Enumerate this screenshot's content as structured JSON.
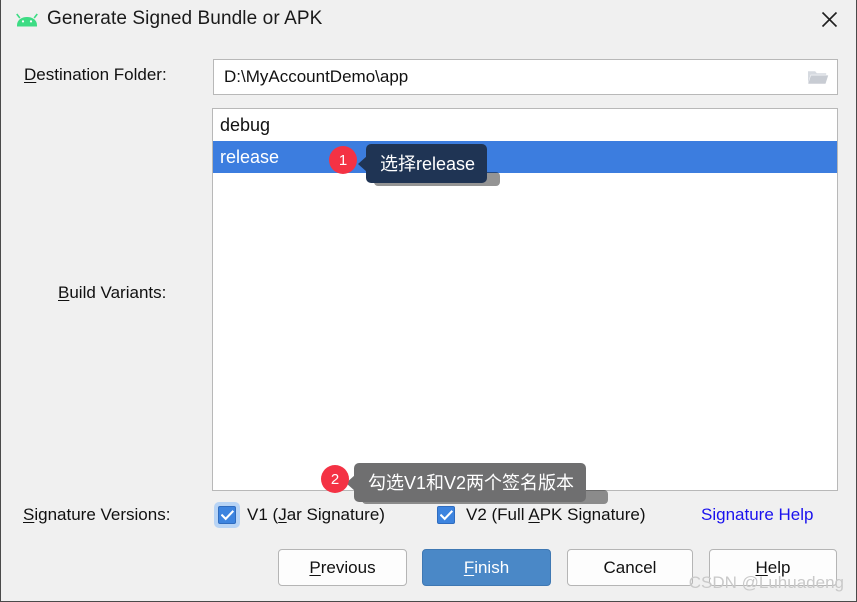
{
  "window": {
    "title": "Generate Signed Bundle or APK",
    "app_icon": "android-robot-icon",
    "close_icon": "close-icon"
  },
  "destination": {
    "label_pre": "D",
    "label_post": "estination Folder:",
    "value": "D:\\MyAccountDemo\\app",
    "placeholder": "Destination Folder",
    "browse_icon": "folder-open-icon"
  },
  "build_variants": {
    "label_pre": "B",
    "label_post": "uild Variants:",
    "items": [
      {
        "label": "debug",
        "selected": false
      },
      {
        "label": "release",
        "selected": true
      }
    ]
  },
  "signature": {
    "label_pre": "S",
    "label_post": "ignature Versions:",
    "v1": {
      "label_a": "V1 (",
      "label_acc": "J",
      "label_b": "ar Signature)",
      "checked": true,
      "focused": true
    },
    "v2": {
      "label_a": "V2 (Full ",
      "label_acc": "A",
      "label_b": "PK Signature)",
      "checked": true,
      "focused": false
    },
    "help_link": "Signature Help"
  },
  "buttons": {
    "previous": {
      "acc": "P",
      "rest": "revious"
    },
    "finish": {
      "acc": "F",
      "rest": "inish"
    },
    "cancel": {
      "acc": "",
      "rest": "Cancel"
    },
    "help": {
      "acc": "H",
      "rest": "elp"
    }
  },
  "annotations": [
    {
      "badge": "1",
      "text": "选择release"
    },
    {
      "badge": "2",
      "text": "勾选V1和V2两个签名版本"
    }
  ],
  "watermark": "CSDN @Luhuadeng",
  "colors": {
    "selection_blue": "#3c7ddf",
    "default_button_blue": "#4a88c7",
    "link_blue": "#1a12ee",
    "badge_red": "#f43244",
    "tooltip_dark": "#1f3454",
    "tooltip_gray": "#6f6f70",
    "android_green": "#3ddc84"
  }
}
